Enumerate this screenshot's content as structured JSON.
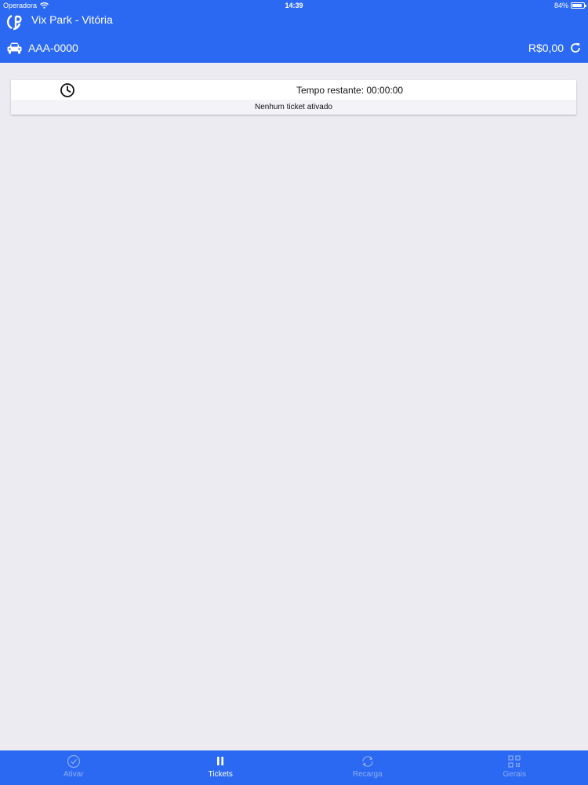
{
  "status_bar": {
    "carrier": "Operadora",
    "time": "14:39",
    "battery": "84%",
    "battery_level": 0.84
  },
  "header": {
    "title": "Vix Park - Vitória",
    "plate": "AAA-0000",
    "balance": "R$0,00"
  },
  "ticket_card": {
    "remaining": "Tempo restante: 00:00:00",
    "message": "Nenhum ticket ativado"
  },
  "tabs": [
    {
      "label": "Ativar",
      "icon": "check-circle-icon",
      "active": false
    },
    {
      "label": "Tickets",
      "icon": "pause-icon",
      "active": true
    },
    {
      "label": "Recarga",
      "icon": "refresh-circle-icon",
      "active": false
    },
    {
      "label": "Gerais",
      "icon": "qr-code-icon",
      "active": false
    }
  ],
  "colors": {
    "brand_blue": "#2B69F2",
    "background": "#ECEBF1"
  }
}
